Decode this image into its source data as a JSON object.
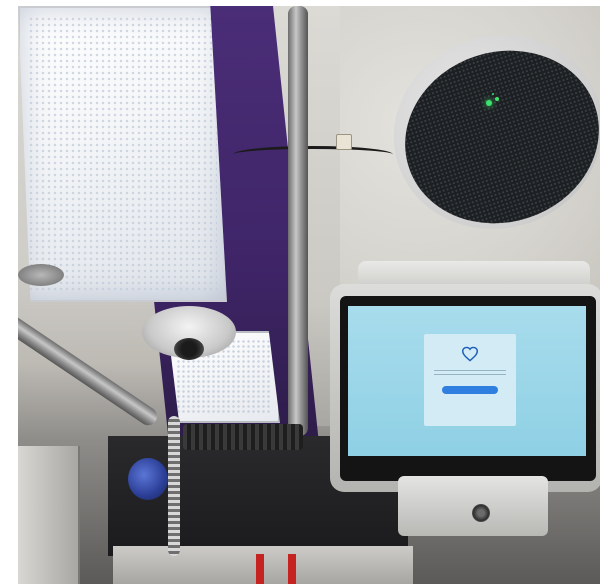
{
  "scene": {
    "kind": "photo",
    "subject": "ambulance-cabin-ceiling",
    "objects": [
      "ceiling-light",
      "grab-rail",
      "dome-camera",
      "ceiling-speaker",
      "rugged-tablet",
      "tablet-mount",
      "storage-cabinets"
    ]
  },
  "tablet": {
    "screen_status_left": "",
    "screen_status_right": "",
    "dialog_icon": "heart-icon",
    "accent_color": "#2f7fe0"
  },
  "speaker": {
    "led_color": "#3ce36a"
  },
  "colors": {
    "trim_purple": "#4a2d77",
    "stripe_red": "#c4231f"
  }
}
